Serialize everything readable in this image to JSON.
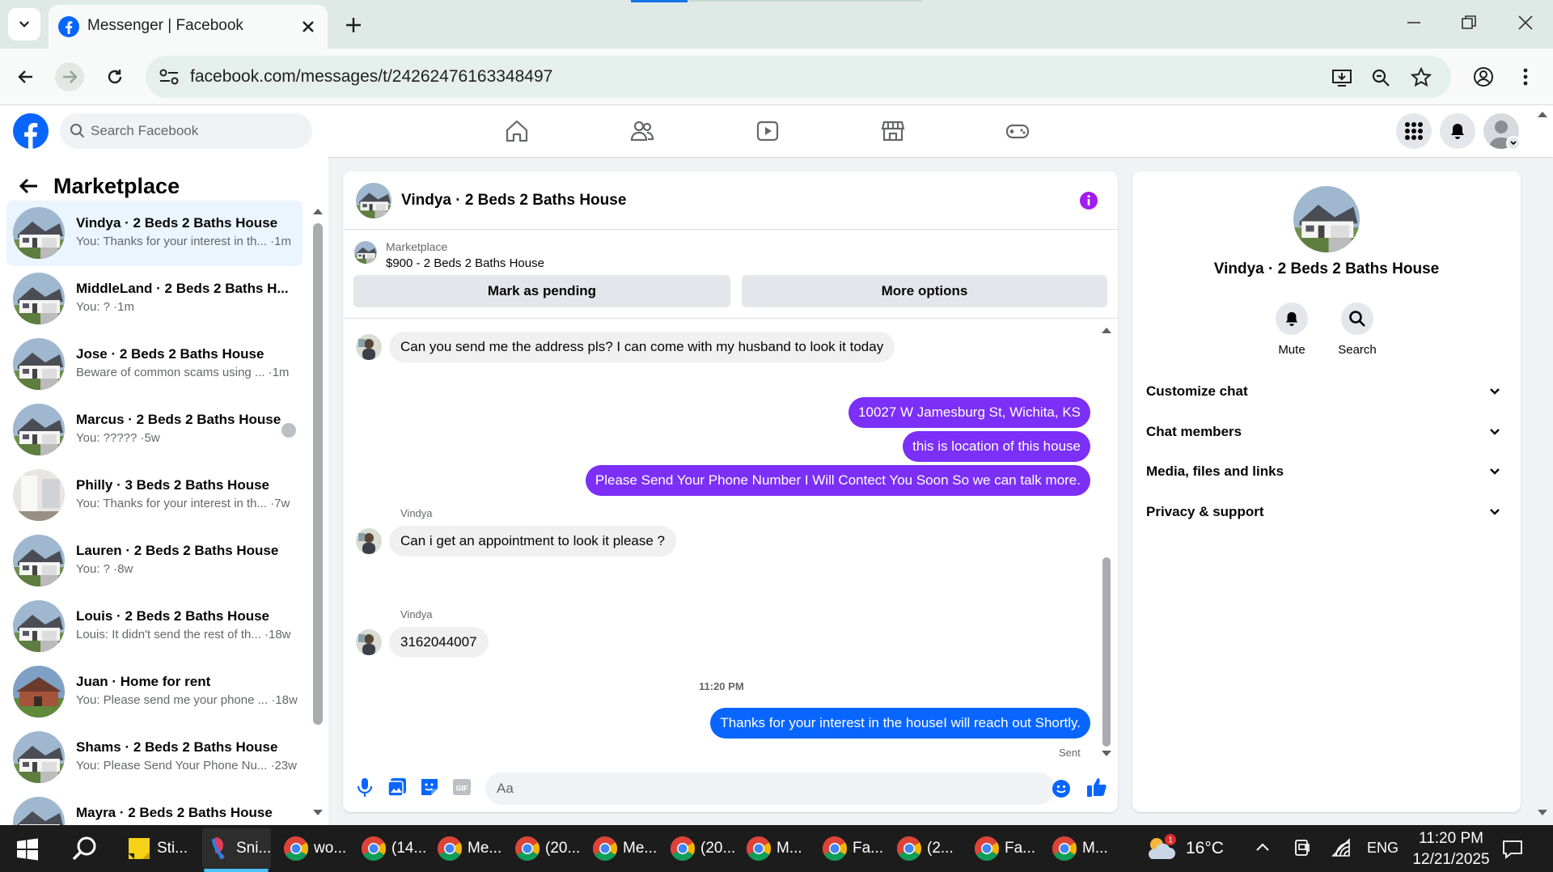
{
  "browser": {
    "tab_title": "Messenger | Facebook",
    "url": "facebook.com/messages/t/24262476163348497"
  },
  "facebook": {
    "search_placeholder": "Search Facebook"
  },
  "sidebar": {
    "title": "Marketplace",
    "conversations": [
      {
        "name": "Vindya · 2 Beds 2 Baths House",
        "preview": "You: Thanks for your interest in th... ·1m",
        "thumb": "house"
      },
      {
        "name": "MiddleLand · 2 Beds 2 Baths H...",
        "preview": "You: ? ·1m",
        "thumb": "house"
      },
      {
        "name": "Jose · 2 Beds 2 Baths House",
        "preview": "Beware of common scams using ... ·1m",
        "thumb": "house"
      },
      {
        "name": "Marcus · 2 Beds 2 Baths House",
        "preview": "You: ????? ·5w",
        "thumb": "house"
      },
      {
        "name": "Philly · 3 Beds 2 Baths House",
        "preview": "You: Thanks for your interest in th... ·7w",
        "thumb": "interior"
      },
      {
        "name": "Lauren · 2 Beds 2 Baths House",
        "preview": "You: ? ·8w",
        "thumb": "house"
      },
      {
        "name": "Louis · 2 Beds 2 Baths House",
        "preview": "Louis: It didn't send the rest of th... ·18w",
        "thumb": "house"
      },
      {
        "name": "Juan · Home for rent",
        "preview": "You: Please send me your phone ... ·18w",
        "thumb": "brick"
      },
      {
        "name": "Shams · 2 Beds 2 Baths House",
        "preview": "You: Please Send Your Phone Nu... ·23w",
        "thumb": "house"
      },
      {
        "name": "Mayra · 2 Beds 2 Baths House",
        "preview": "",
        "thumb": "house"
      }
    ]
  },
  "chat": {
    "title": "Vindya · 2 Beds 2 Baths House",
    "marketplace_label": "Marketplace",
    "listing": "$900 - 2 Beds 2 Baths House",
    "mark_pending": "Mark as pending",
    "more_options": "More options",
    "messages": {
      "m1": "Can you send me the address pls? I can come with my husband to look it today",
      "m2": "10027 W Jamesburg St, Wichita, KS",
      "m3": "this is location of this house",
      "m4": "Please Send Your Phone Number I Will Contect You Soon So we can talk more.",
      "sender1": "Vindya",
      "m5": "Can i get an appointment to look it please ?",
      "sender2": "Vindya",
      "m6": "3162044007",
      "timestamp": "11:20 PM",
      "m7": "Thanks for your interest in the houseI will reach out Shortly.",
      "status": "Sent"
    },
    "composer_placeholder": "Aa"
  },
  "info_panel": {
    "name": "Vindya · 2 Beds 2 Baths House",
    "actions": [
      "Mute",
      "Search"
    ],
    "sections": [
      "Customize chat",
      "Chat members",
      "Media, files and links",
      "Privacy & support"
    ]
  },
  "taskbar": {
    "apps": [
      {
        "label": "Sti...",
        "icon": "sticky-notes"
      },
      {
        "label": "Sni...",
        "icon": "snipping-tool"
      },
      {
        "label": "wo...",
        "icon": "chrome"
      },
      {
        "label": "(14...",
        "icon": "chrome"
      },
      {
        "label": "Me...",
        "icon": "chrome"
      },
      {
        "label": "(20...",
        "icon": "chrome"
      },
      {
        "label": "Me...",
        "icon": "chrome"
      },
      {
        "label": "(20...",
        "icon": "chrome"
      },
      {
        "label": "M...",
        "icon": "chrome"
      },
      {
        "label": "Fa...",
        "icon": "chrome"
      },
      {
        "label": "(2...",
        "icon": "chrome"
      },
      {
        "label": "Fa...",
        "icon": "chrome"
      },
      {
        "label": "M...",
        "icon": "chrome"
      }
    ],
    "weather_badge": "1",
    "temperature": "16°C",
    "language": "ENG",
    "time": "11:20 PM",
    "date": "12/21/2025"
  },
  "colors": {
    "fb_blue": "#0866ff",
    "outgoing_purple": "#7b2ff7",
    "incoming_gray": "#f0f0f0"
  }
}
